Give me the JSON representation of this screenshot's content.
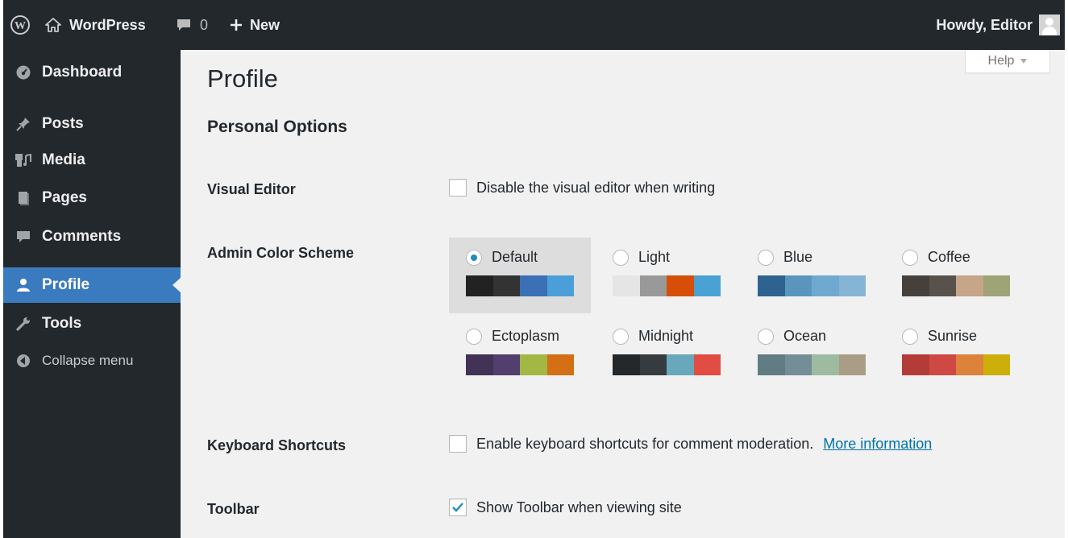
{
  "adminbar": {
    "site_name": "WordPress",
    "comment_count": "0",
    "new_label": "New",
    "howdy": "Howdy, Editor"
  },
  "sidebar": {
    "items": [
      {
        "label": "Dashboard",
        "icon": "dashboard-icon"
      },
      {
        "label": "Posts",
        "icon": "pin-icon"
      },
      {
        "label": "Media",
        "icon": "media-icon"
      },
      {
        "label": "Pages",
        "icon": "pages-icon"
      },
      {
        "label": "Comments",
        "icon": "comment-icon"
      },
      {
        "label": "Profile",
        "icon": "user-icon",
        "current": true
      },
      {
        "label": "Tools",
        "icon": "wrench-icon"
      },
      {
        "label": "Collapse menu",
        "icon": "collapse-arrow-icon"
      }
    ]
  },
  "help_label": "Help",
  "page_title": "Profile",
  "section_title": "Personal Options",
  "fields": {
    "visual_editor": {
      "label": "Visual Editor",
      "option": "Disable the visual editor when writing",
      "checked": false
    },
    "color_scheme": {
      "label": "Admin Color Scheme"
    },
    "keyboard_shortcuts": {
      "label": "Keyboard Shortcuts",
      "option": "Enable keyboard shortcuts for comment moderation.",
      "link": "More information",
      "checked": false
    },
    "toolbar": {
      "label": "Toolbar",
      "option": "Show Toolbar when viewing site",
      "checked": true
    }
  },
  "schemes": [
    {
      "name": "Default",
      "selected": true,
      "colors": [
        "#222222",
        "#333333",
        "#3b6fb6",
        "#4a9fd8"
      ]
    },
    {
      "name": "Light",
      "selected": false,
      "colors": [
        "#e5e5e5",
        "#999999",
        "#d64e07",
        "#4aa1d4"
      ]
    },
    {
      "name": "Blue",
      "selected": false,
      "colors": [
        "#2e6390",
        "#5a95bd",
        "#70a9cf",
        "#84b5d4"
      ]
    },
    {
      "name": "Coffee",
      "selected": false,
      "colors": [
        "#46403c",
        "#59524c",
        "#c7a589",
        "#9ea476"
      ]
    },
    {
      "name": "Ectoplasm",
      "selected": false,
      "colors": [
        "#413256",
        "#523f6d",
        "#a3b745",
        "#d46f15"
      ]
    },
    {
      "name": "Midnight",
      "selected": false,
      "colors": [
        "#25282b",
        "#363b3f",
        "#69a8bb",
        "#e14d43"
      ]
    },
    {
      "name": "Ocean",
      "selected": false,
      "colors": [
        "#627c83",
        "#738e96",
        "#9ebaa0",
        "#aa9d88"
      ]
    },
    {
      "name": "Sunrise",
      "selected": false,
      "colors": [
        "#b43c38",
        "#cf4944",
        "#dd823b",
        "#ccaf0b"
      ]
    }
  ],
  "colors": {
    "adminbar_bg": "#23282d",
    "current_menu_bg": "#3a7bbf",
    "content_bg": "#f1f1f1",
    "link": "#0073aa"
  }
}
